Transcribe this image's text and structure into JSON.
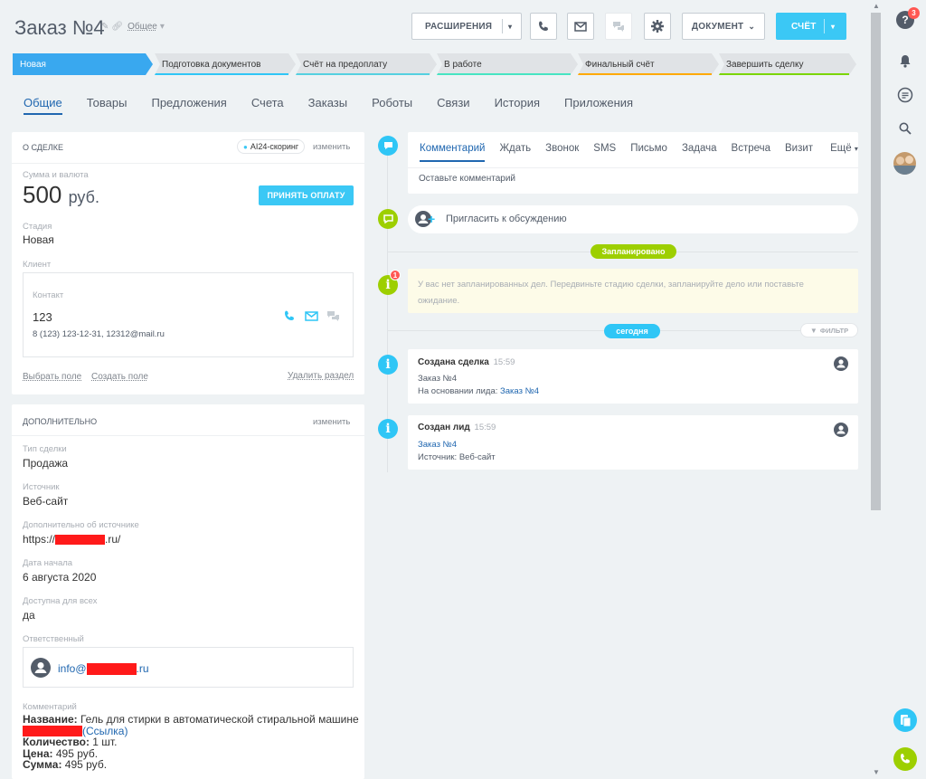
{
  "header": {
    "title": "Заказ №4",
    "category": "Общее"
  },
  "toolbar": {
    "extensions": "РАСШИРЕНИЯ",
    "document": "ДОКУМЕНТ",
    "invoice": "СЧЁТ"
  },
  "stages": [
    {
      "label": "Новая",
      "color": "#39a8ef"
    },
    {
      "label": "Подготовка документов",
      "color": "#2fc6f6"
    },
    {
      "label": "Счёт на предоплату",
      "color": "#55d0e0"
    },
    {
      "label": "В работе",
      "color": "#47e4c2"
    },
    {
      "label": "Финальный счёт",
      "color": "#ffa900"
    },
    {
      "label": "Завершить сделку",
      "color": "#7bd500"
    }
  ],
  "tabs": [
    "Общие",
    "Товары",
    "Предложения",
    "Счета",
    "Заказы",
    "Роботы",
    "Связи",
    "История",
    "Приложения"
  ],
  "deal": {
    "heading": "О СДЕЛКЕ",
    "scoring": "AI24-скоринг",
    "edit": "изменить",
    "sum_label": "Сумма и валюта",
    "sum_value": "500",
    "currency": "руб.",
    "pay_button": "ПРИНЯТЬ ОПЛАТУ",
    "stage_label": "Стадия",
    "stage_value": "Новая",
    "client_label": "Клиент",
    "contact_label": "Контакт",
    "contact_name": "123",
    "contact_info": "8 (123) 123-12-31, 12312@mail.ru",
    "select_field": "Выбрать поле",
    "create_field": "Создать поле",
    "delete_section": "Удалить раздел"
  },
  "extra": {
    "heading": "ДОПОЛНИТЕЛЬНО",
    "edit": "изменить",
    "type_label": "Тип сделки",
    "type_value": "Продажа",
    "source_label": "Источник",
    "source_value": "Веб-сайт",
    "source_more_label": "Дополнительно об источнике",
    "source_more_pre": "https://",
    "source_more_post": ".ru/",
    "start_label": "Дата начала",
    "start_value": "6 августа 2020",
    "access_label": "Доступна для всех",
    "access_value": "да",
    "resp_label": "Ответственный",
    "resp_pre": "info@",
    "resp_post": ".ru",
    "comment_label": "Комментарий",
    "name_key": "Название:",
    "name_value": " Гель для стирки в автоматической стиральной машине",
    "link": "(Ссылка)",
    "qty_key": "Количество:",
    "qty_value": " 1 шт.",
    "price_key": "Цена:",
    "price_value": " 495 руб.",
    "total_key": "Сумма:",
    "total_value": " 495 руб."
  },
  "timeline": {
    "tabs": [
      "Комментарий",
      "Ждать",
      "Звонок",
      "SMS",
      "Письмо",
      "Задача",
      "Встреча",
      "Визит",
      "Ещё"
    ],
    "comment_placeholder": "Оставьте комментарий",
    "invite": "Пригласить к обсуждению",
    "planned_badge": "Запланировано",
    "planned_notice_badge": "1",
    "planned_text": "У вас нет запланированных дел. Передвиньте стадию сделки, запланируйте дело или поставьте ожидание.",
    "today_badge": "сегодня",
    "filter": "ФИЛЬТР",
    "events": [
      {
        "title": "Создана сделка",
        "time": "15:59",
        "line1": "Заказ №4",
        "line2_pre": "На основании лида: ",
        "line2_link": "Заказ №4"
      },
      {
        "title": "Создан лид",
        "time": "15:59",
        "line1_link": "Заказ №4",
        "line2": "Источник: Веб-сайт"
      }
    ]
  },
  "rightbar": {
    "help_badge": "3"
  },
  "colors": {
    "accent": "#3bc8f5",
    "link": "#2067b0",
    "green": "#9dcf00"
  }
}
